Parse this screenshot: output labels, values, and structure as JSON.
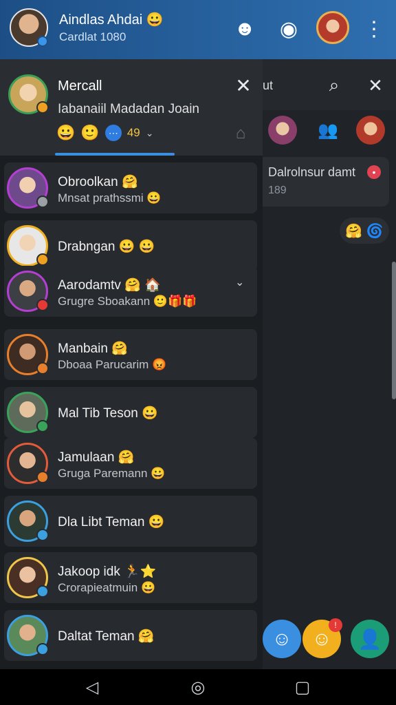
{
  "topbar": {
    "name": "Aindlas Ahdai 😀",
    "subtitle": "Cardlat 1080",
    "icons": [
      "chatbot-icon",
      "camera-icon",
      "profile-avatar",
      "more-vertical-icon"
    ]
  },
  "drawer": {
    "profile": {
      "name": "Mercall",
      "subtitle": "Iabanaiil Madadan Joain",
      "tag": "49",
      "emojis": [
        "😀",
        "🙂"
      ]
    },
    "contacts": [
      {
        "name": "Obroolkan 🤗",
        "status": "Mnsat prathssmi 😀",
        "ring": "#b43fd2",
        "badge": "#9aa0a6"
      },
      {
        "name": "Drabngan 😀 😀",
        "status": "",
        "ring": "#f0b020",
        "badge": "#f0a020"
      },
      {
        "name": "Aarodamtv 🤗 🏠",
        "status": "Grugre Sboakann 🙂🎁🎁",
        "ring": "#b43fd2",
        "badge": "#e53935"
      },
      {
        "name": "Manbain 🤗",
        "status": "Dboaa Parucarim 😡",
        "ring": "#e87f2b",
        "badge": "#e87f2b"
      },
      {
        "name": "Mal Tib Teson 😀",
        "status": "",
        "ring": "#3aa35a",
        "badge": "#3aa35a"
      },
      {
        "name": "Jamulaan 🤗",
        "status": "Gruga Paremann 😀",
        "ring": "#e25b3a",
        "badge": "#e87f2b"
      },
      {
        "name": "Dla Libt Teman 😀",
        "status": "",
        "ring": "#3aa0e0",
        "badge": "#3aa0e0"
      },
      {
        "name": "Jakoop idk 🏃⭐",
        "status": "Crorapieatmuin 😀",
        "ring": "#f0c64a",
        "badge": "#3aa0e0"
      },
      {
        "name": "Daltat Teman 🤗",
        "status": "",
        "ring": "#3aa0e0",
        "badge": "#3aa0e0"
      }
    ]
  },
  "chat": {
    "header_text": "ut",
    "message": {
      "name": "Dalrolnsur damt",
      "count": "189"
    },
    "reactions": "🤗 🌀"
  },
  "colors": {
    "topbar_start": "#1d4f86",
    "topbar_end": "#2f6fb0",
    "accent": "#3b8fe0",
    "unread": "#e04352"
  }
}
